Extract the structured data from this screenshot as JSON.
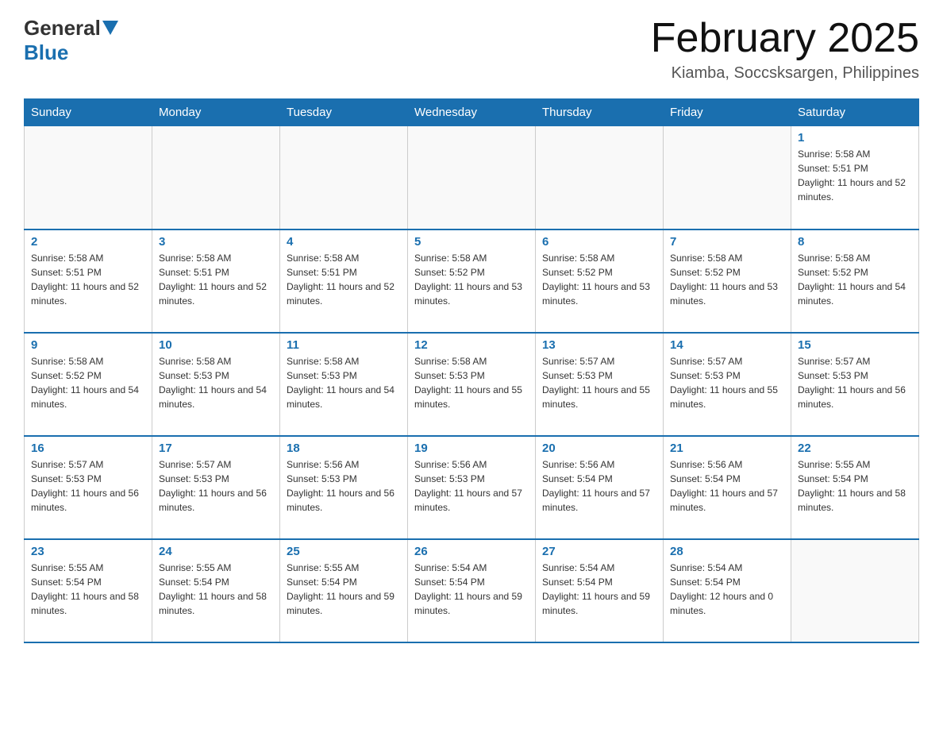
{
  "header": {
    "logo_general": "General",
    "logo_blue": "Blue",
    "month_title": "February 2025",
    "location": "Kiamba, Soccsksargen, Philippines"
  },
  "weekdays": [
    "Sunday",
    "Monday",
    "Tuesday",
    "Wednesday",
    "Thursday",
    "Friday",
    "Saturday"
  ],
  "weeks": [
    [
      {
        "day": "",
        "sunrise": "",
        "sunset": "",
        "daylight": ""
      },
      {
        "day": "",
        "sunrise": "",
        "sunset": "",
        "daylight": ""
      },
      {
        "day": "",
        "sunrise": "",
        "sunset": "",
        "daylight": ""
      },
      {
        "day": "",
        "sunrise": "",
        "sunset": "",
        "daylight": ""
      },
      {
        "day": "",
        "sunrise": "",
        "sunset": "",
        "daylight": ""
      },
      {
        "day": "",
        "sunrise": "",
        "sunset": "",
        "daylight": ""
      },
      {
        "day": "1",
        "sunrise": "Sunrise: 5:58 AM",
        "sunset": "Sunset: 5:51 PM",
        "daylight": "Daylight: 11 hours and 52 minutes."
      }
    ],
    [
      {
        "day": "2",
        "sunrise": "Sunrise: 5:58 AM",
        "sunset": "Sunset: 5:51 PM",
        "daylight": "Daylight: 11 hours and 52 minutes."
      },
      {
        "day": "3",
        "sunrise": "Sunrise: 5:58 AM",
        "sunset": "Sunset: 5:51 PM",
        "daylight": "Daylight: 11 hours and 52 minutes."
      },
      {
        "day": "4",
        "sunrise": "Sunrise: 5:58 AM",
        "sunset": "Sunset: 5:51 PM",
        "daylight": "Daylight: 11 hours and 52 minutes."
      },
      {
        "day": "5",
        "sunrise": "Sunrise: 5:58 AM",
        "sunset": "Sunset: 5:52 PM",
        "daylight": "Daylight: 11 hours and 53 minutes."
      },
      {
        "day": "6",
        "sunrise": "Sunrise: 5:58 AM",
        "sunset": "Sunset: 5:52 PM",
        "daylight": "Daylight: 11 hours and 53 minutes."
      },
      {
        "day": "7",
        "sunrise": "Sunrise: 5:58 AM",
        "sunset": "Sunset: 5:52 PM",
        "daylight": "Daylight: 11 hours and 53 minutes."
      },
      {
        "day": "8",
        "sunrise": "Sunrise: 5:58 AM",
        "sunset": "Sunset: 5:52 PM",
        "daylight": "Daylight: 11 hours and 54 minutes."
      }
    ],
    [
      {
        "day": "9",
        "sunrise": "Sunrise: 5:58 AM",
        "sunset": "Sunset: 5:52 PM",
        "daylight": "Daylight: 11 hours and 54 minutes."
      },
      {
        "day": "10",
        "sunrise": "Sunrise: 5:58 AM",
        "sunset": "Sunset: 5:53 PM",
        "daylight": "Daylight: 11 hours and 54 minutes."
      },
      {
        "day": "11",
        "sunrise": "Sunrise: 5:58 AM",
        "sunset": "Sunset: 5:53 PM",
        "daylight": "Daylight: 11 hours and 54 minutes."
      },
      {
        "day": "12",
        "sunrise": "Sunrise: 5:58 AM",
        "sunset": "Sunset: 5:53 PM",
        "daylight": "Daylight: 11 hours and 55 minutes."
      },
      {
        "day": "13",
        "sunrise": "Sunrise: 5:57 AM",
        "sunset": "Sunset: 5:53 PM",
        "daylight": "Daylight: 11 hours and 55 minutes."
      },
      {
        "day": "14",
        "sunrise": "Sunrise: 5:57 AM",
        "sunset": "Sunset: 5:53 PM",
        "daylight": "Daylight: 11 hours and 55 minutes."
      },
      {
        "day": "15",
        "sunrise": "Sunrise: 5:57 AM",
        "sunset": "Sunset: 5:53 PM",
        "daylight": "Daylight: 11 hours and 56 minutes."
      }
    ],
    [
      {
        "day": "16",
        "sunrise": "Sunrise: 5:57 AM",
        "sunset": "Sunset: 5:53 PM",
        "daylight": "Daylight: 11 hours and 56 minutes."
      },
      {
        "day": "17",
        "sunrise": "Sunrise: 5:57 AM",
        "sunset": "Sunset: 5:53 PM",
        "daylight": "Daylight: 11 hours and 56 minutes."
      },
      {
        "day": "18",
        "sunrise": "Sunrise: 5:56 AM",
        "sunset": "Sunset: 5:53 PM",
        "daylight": "Daylight: 11 hours and 56 minutes."
      },
      {
        "day": "19",
        "sunrise": "Sunrise: 5:56 AM",
        "sunset": "Sunset: 5:53 PM",
        "daylight": "Daylight: 11 hours and 57 minutes."
      },
      {
        "day": "20",
        "sunrise": "Sunrise: 5:56 AM",
        "sunset": "Sunset: 5:54 PM",
        "daylight": "Daylight: 11 hours and 57 minutes."
      },
      {
        "day": "21",
        "sunrise": "Sunrise: 5:56 AM",
        "sunset": "Sunset: 5:54 PM",
        "daylight": "Daylight: 11 hours and 57 minutes."
      },
      {
        "day": "22",
        "sunrise": "Sunrise: 5:55 AM",
        "sunset": "Sunset: 5:54 PM",
        "daylight": "Daylight: 11 hours and 58 minutes."
      }
    ],
    [
      {
        "day": "23",
        "sunrise": "Sunrise: 5:55 AM",
        "sunset": "Sunset: 5:54 PM",
        "daylight": "Daylight: 11 hours and 58 minutes."
      },
      {
        "day": "24",
        "sunrise": "Sunrise: 5:55 AM",
        "sunset": "Sunset: 5:54 PM",
        "daylight": "Daylight: 11 hours and 58 minutes."
      },
      {
        "day": "25",
        "sunrise": "Sunrise: 5:55 AM",
        "sunset": "Sunset: 5:54 PM",
        "daylight": "Daylight: 11 hours and 59 minutes."
      },
      {
        "day": "26",
        "sunrise": "Sunrise: 5:54 AM",
        "sunset": "Sunset: 5:54 PM",
        "daylight": "Daylight: 11 hours and 59 minutes."
      },
      {
        "day": "27",
        "sunrise": "Sunrise: 5:54 AM",
        "sunset": "Sunset: 5:54 PM",
        "daylight": "Daylight: 11 hours and 59 minutes."
      },
      {
        "day": "28",
        "sunrise": "Sunrise: 5:54 AM",
        "sunset": "Sunset: 5:54 PM",
        "daylight": "Daylight: 12 hours and 0 minutes."
      },
      {
        "day": "",
        "sunrise": "",
        "sunset": "",
        "daylight": ""
      }
    ]
  ]
}
